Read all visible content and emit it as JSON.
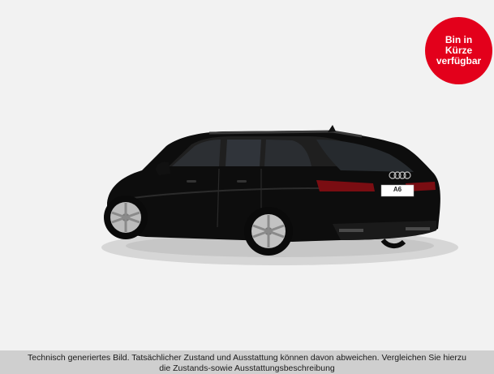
{
  "badge": {
    "line1": "Bin in",
    "line2": "Kürze",
    "line3": "verfügbar",
    "color": "#e3001b"
  },
  "vehicle": {
    "plate_text": "A6",
    "image_icon": "car-rear-view-illustration"
  },
  "caption": {
    "line1": "Technisch generiertes Bild. Tatsächlicher Zustand und Ausstattung können davon abweichen. Vergleichen Sie hierzu",
    "line2": "die Zustands-sowie Ausstattungsbeschreibung"
  }
}
